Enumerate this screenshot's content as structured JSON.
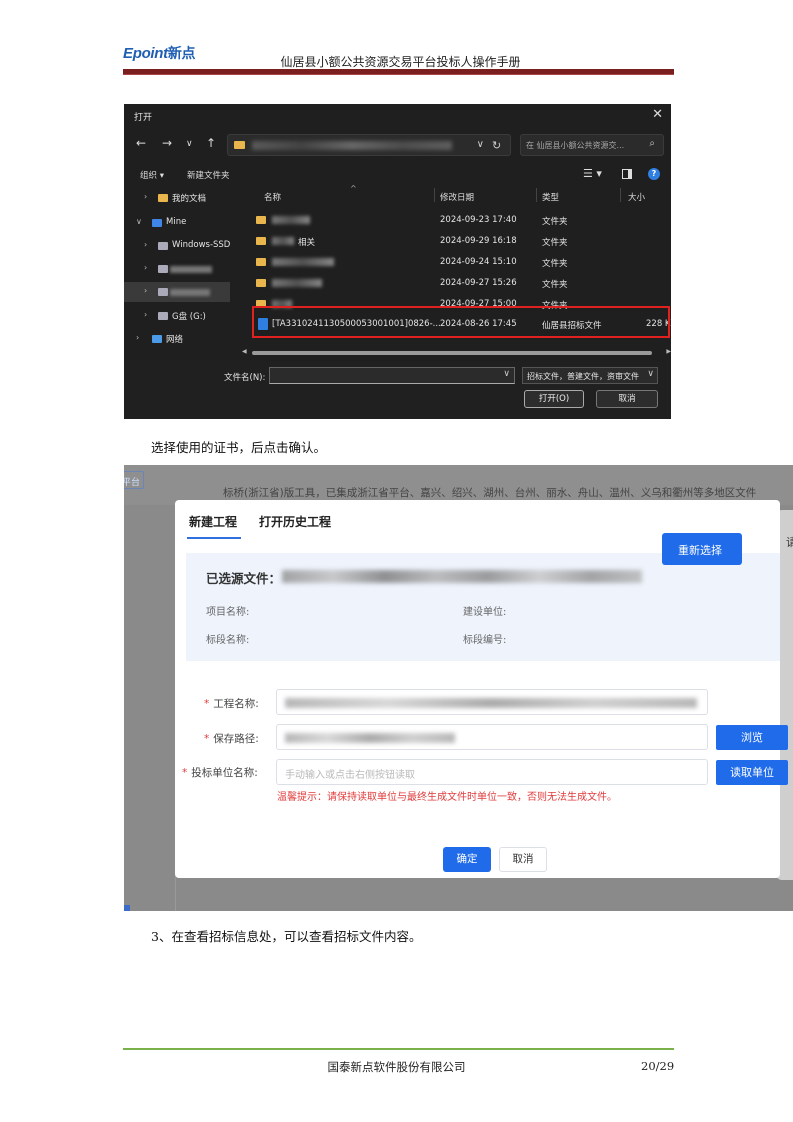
{
  "header": {
    "logo_en": "Epoint",
    "logo_cn": "新点",
    "doc_title": "仙居县小额公共资源交易平台投标人操作手册"
  },
  "file_dialog": {
    "title": "打开",
    "search_placeholder": "在 仙居县小额公共资源交...",
    "organize": "组织 ▾",
    "new_folder": "新建文件夹",
    "sidebar": [
      {
        "label": "我的文档",
        "icon": "folder-icon"
      },
      {
        "label": "Mine",
        "icon": "monitor-icon"
      },
      {
        "label": "Windows-SSD",
        "icon": "drive-icon"
      },
      {
        "label": "",
        "icon": "drive-icon"
      },
      {
        "label": "",
        "icon": "drive-icon"
      },
      {
        "label": "G盘 (G:)",
        "icon": "drive-icon"
      },
      {
        "label": "网络",
        "icon": "network-icon"
      }
    ],
    "columns": [
      "名称",
      "修改日期",
      "类型",
      "大小"
    ],
    "rows": [
      {
        "name": "",
        "date": "2024-09-23 17:40",
        "type": "文件夹",
        "size": ""
      },
      {
        "name": "相关",
        "date": "2024-09-29 16:18",
        "type": "文件夹",
        "size": ""
      },
      {
        "name": "",
        "date": "2024-09-24 15:10",
        "type": "文件夹",
        "size": ""
      },
      {
        "name": "",
        "date": "2024-09-27 15:26",
        "type": "文件夹",
        "size": ""
      },
      {
        "name": "",
        "date": "2024-09-27 15:00",
        "type": "文件夹",
        "size": ""
      },
      {
        "name": "[TA3310241130500053001001]0826-...",
        "date": "2024-08-26 17:45",
        "type": "仙居县招标文件",
        "size": "228 K"
      }
    ],
    "filename_label": "文件名(N):",
    "filename_value": "",
    "filter": "招标文件，普建文件，资审文件",
    "open_button": "打开(O)",
    "cancel_button": "取消"
  },
  "text1": "选择使用的证书，后点击确认。",
  "web_dialog": {
    "top_button": "平台",
    "banner": "标桥(浙江省)版工具，已集成浙江省平台、嘉兴、绍兴、湖州、台州、丽水、舟山、温州、义乌和衢州等多地区文件",
    "right_panel_text": "请",
    "tabs": [
      "新建工程",
      "打开历史工程"
    ],
    "selected_file_label": "已选源文件：",
    "project_name_label": "项目名称:",
    "build_unit_label": "建设单位:",
    "section_name_label": "标段名称:",
    "section_no_label": "标段编号:",
    "reselect_button": "重新选择",
    "req_mark": "*",
    "project_label": "工程名称:",
    "save_path_label": "保存路径:",
    "bidder_label": "投标单位名称:",
    "bidder_placeholder": "手动输入或点击右侧按钮读取",
    "browse_button": "浏览",
    "read_unit_button": "读取单位",
    "warning": "温馨提示：请保持读取单位与最终生成文件时单位一致，否则无法生成文件。",
    "confirm_button": "确定",
    "cancel_button": "取消"
  },
  "text2": "3、在查看招标信息处，可以查看招标文件内容。",
  "footer": {
    "company": "国泰新点软件股份有限公司",
    "page": "20/29"
  }
}
